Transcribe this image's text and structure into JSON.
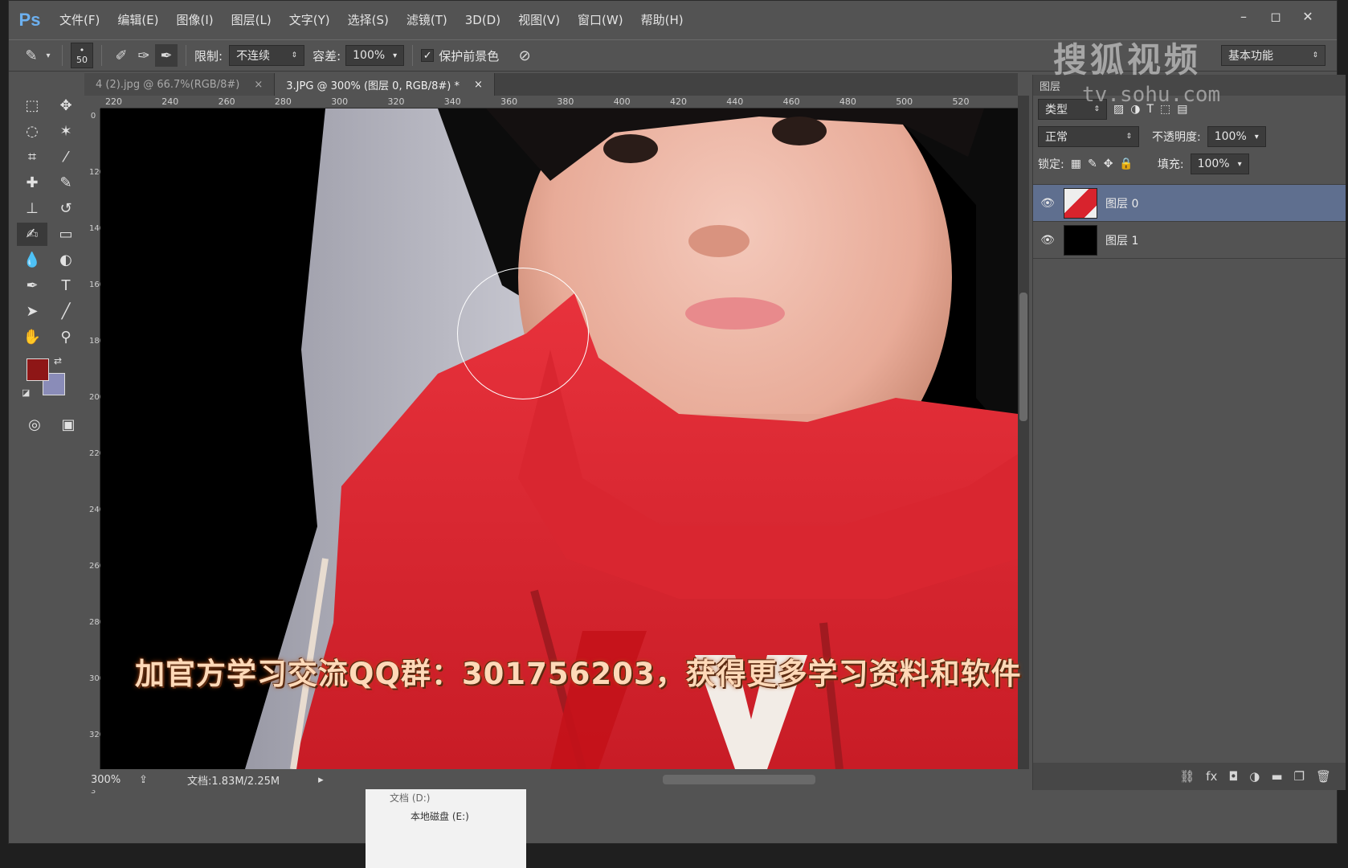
{
  "app": {
    "logo": "Ps",
    "menu": [
      "文件(F)",
      "编辑(E)",
      "图像(I)",
      "图层(L)",
      "文字(Y)",
      "选择(S)",
      "滤镜(T)",
      "3D(D)",
      "视图(V)",
      "窗口(W)",
      "帮助(H)"
    ],
    "window_controls": [
      "–",
      "◻",
      "✕"
    ]
  },
  "options": {
    "brush_size": "50",
    "limit_label": "限制:",
    "limit_value": "不连续",
    "tolerance_label": "容差:",
    "tolerance_value": "100%",
    "protect_fg_label": "保护前景色",
    "protect_fg_checked": "✓",
    "workspace": "基本功能"
  },
  "tabs": [
    {
      "label": "4 (2).jpg @ 66.7%(RGB/8#)",
      "close": "×"
    },
    {
      "label": "3.JPG @ 300% (图层 0, RGB/8#) *",
      "close": "×"
    }
  ],
  "ruler": {
    "h_ticks": [
      "220",
      "240",
      "260",
      "280",
      "300",
      "320",
      "340",
      "360",
      "380",
      "400",
      "420",
      "440",
      "460",
      "480",
      "500",
      "520"
    ],
    "v_ticks": [
      "0",
      "120",
      "140",
      "160",
      "180",
      "200",
      "220",
      "240",
      "260",
      "280",
      "300",
      "320",
      "3"
    ]
  },
  "colors": {
    "foreground": "#8e1616",
    "background": "#8a8cb8",
    "selection": "#5f6f8f"
  },
  "status": {
    "zoom": "300%",
    "doc": "文档:1.83M/2.25M"
  },
  "watermark": {
    "text": "搜狐视频",
    "url": "tv.sohu.com"
  },
  "subtitle": "加官方学习交流QQ群：301756203，获得更多学习资料和软件",
  "layers_panel": {
    "title": "图层",
    "filter_label": "类型",
    "blend_mode": "正常",
    "opacity_label": "不透明度:",
    "opacity_value": "100%",
    "lock_label": "锁定:",
    "fill_label": "填充:",
    "fill_value": "100%",
    "layers": [
      {
        "name": "图层 0",
        "selected": true
      },
      {
        "name": "图层 1",
        "selected": false
      }
    ],
    "footer_icons": [
      "link-icon",
      "fx-icon",
      "mask-icon",
      "adjustment-icon",
      "folder-icon",
      "new-layer-icon",
      "trash-icon"
    ]
  },
  "explorer": {
    "items": [
      "文档 (D:)",
      "本地磁盘 (E:)"
    ]
  }
}
